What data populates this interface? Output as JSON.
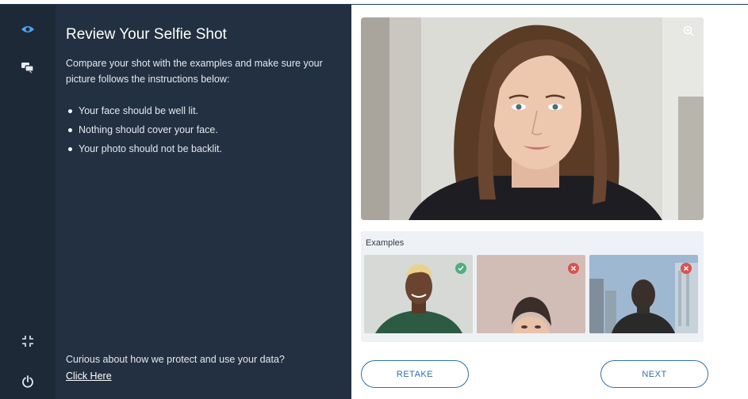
{
  "panel": {
    "title": "Review Your Selfie Shot",
    "intro": "Compare your shot with the examples and make sure your picture follows the instructions below:",
    "instructions": [
      "Your face should be well lit.",
      "Nothing should cover your face.",
      "Your photo should not be backlit."
    ],
    "privacy_text": "Curious about how we protect and use your data?",
    "privacy_link": "Click Here"
  },
  "rail": {
    "icons": [
      "eye-icon",
      "chat-icon",
      "collapse-icon",
      "power-icon"
    ]
  },
  "preview": {
    "zoom_icon": "zoom-icon"
  },
  "examples": {
    "label": "Examples",
    "items": [
      {
        "status": "good",
        "icon": "check-icon",
        "color": "#4caf7d"
      },
      {
        "status": "bad",
        "icon": "x-icon",
        "color": "#d9534f"
      },
      {
        "status": "bad",
        "icon": "x-icon",
        "color": "#d9534f"
      }
    ]
  },
  "actions": {
    "retake_label": "RETAKE",
    "next_label": "NEXT"
  },
  "colors": {
    "panel_bg": "#233041",
    "rail_bg": "#1d2937",
    "accent": "#2f6fad",
    "active_icon": "#4da3ff"
  }
}
